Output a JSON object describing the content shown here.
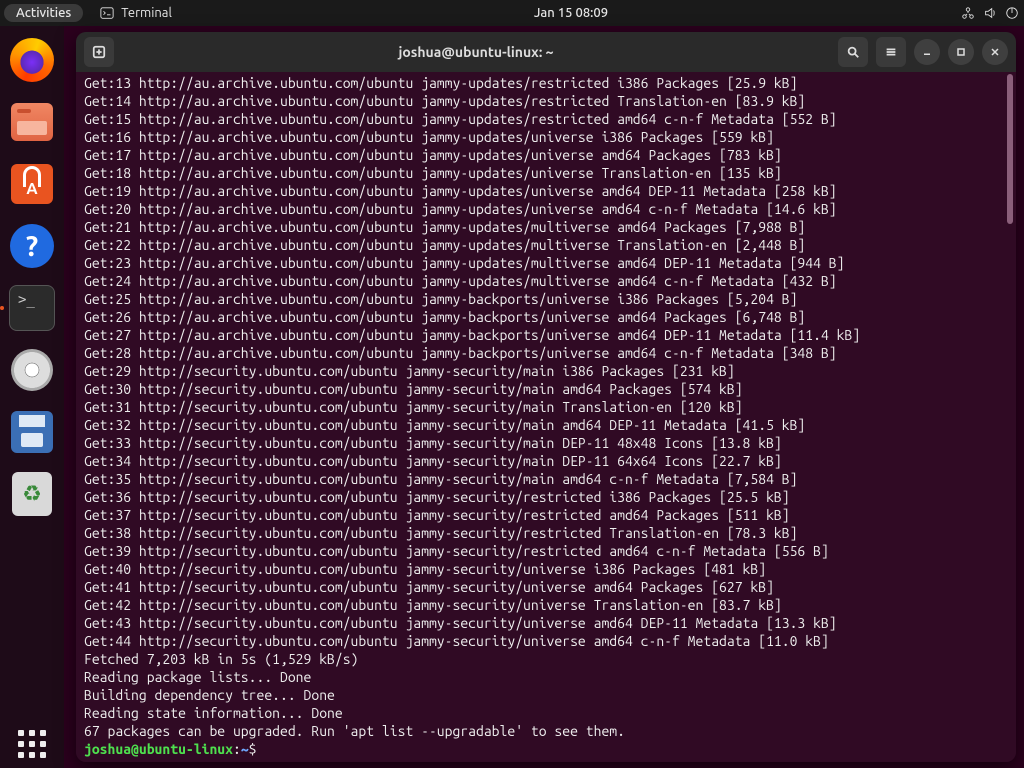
{
  "topbar": {
    "activities": "Activities",
    "app_label": "Terminal",
    "clock": "Jan 15  08:09"
  },
  "dock": {
    "items": [
      {
        "name": "firefox",
        "label": "Firefox"
      },
      {
        "name": "files",
        "label": "Files"
      },
      {
        "name": "software",
        "label": "Ubuntu Software"
      },
      {
        "name": "help",
        "label": "Help"
      },
      {
        "name": "terminal",
        "label": "Terminal",
        "active": true
      },
      {
        "name": "disks",
        "label": "Disk"
      },
      {
        "name": "save",
        "label": "Save"
      },
      {
        "name": "trash",
        "label": "Trash"
      }
    ],
    "show_apps": "Show Applications"
  },
  "window": {
    "title": "joshua@ubuntu-linux: ~",
    "new_tab_tooltip": "New Tab",
    "search_tooltip": "Search",
    "menu_tooltip": "Menu",
    "min_tooltip": "Minimize",
    "max_tooltip": "Maximize",
    "close_tooltip": "Close"
  },
  "terminal": {
    "lines": [
      "Get:13 http://au.archive.ubuntu.com/ubuntu jammy-updates/restricted i386 Packages [25.9 kB]",
      "Get:14 http://au.archive.ubuntu.com/ubuntu jammy-updates/restricted Translation-en [83.9 kB]",
      "Get:15 http://au.archive.ubuntu.com/ubuntu jammy-updates/restricted amd64 c-n-f Metadata [552 B]",
      "Get:16 http://au.archive.ubuntu.com/ubuntu jammy-updates/universe i386 Packages [559 kB]",
      "Get:17 http://au.archive.ubuntu.com/ubuntu jammy-updates/universe amd64 Packages [783 kB]",
      "Get:18 http://au.archive.ubuntu.com/ubuntu jammy-updates/universe Translation-en [135 kB]",
      "Get:19 http://au.archive.ubuntu.com/ubuntu jammy-updates/universe amd64 DEP-11 Metadata [258 kB]",
      "Get:20 http://au.archive.ubuntu.com/ubuntu jammy-updates/universe amd64 c-n-f Metadata [14.6 kB]",
      "Get:21 http://au.archive.ubuntu.com/ubuntu jammy-updates/multiverse amd64 Packages [7,988 B]",
      "Get:22 http://au.archive.ubuntu.com/ubuntu jammy-updates/multiverse Translation-en [2,448 B]",
      "Get:23 http://au.archive.ubuntu.com/ubuntu jammy-updates/multiverse amd64 DEP-11 Metadata [944 B]",
      "Get:24 http://au.archive.ubuntu.com/ubuntu jammy-updates/multiverse amd64 c-n-f Metadata [432 B]",
      "Get:25 http://au.archive.ubuntu.com/ubuntu jammy-backports/universe i386 Packages [5,204 B]",
      "Get:26 http://au.archive.ubuntu.com/ubuntu jammy-backports/universe amd64 Packages [6,748 B]",
      "Get:27 http://au.archive.ubuntu.com/ubuntu jammy-backports/universe amd64 DEP-11 Metadata [11.4 kB]",
      "Get:28 http://au.archive.ubuntu.com/ubuntu jammy-backports/universe amd64 c-n-f Metadata [348 B]",
      "Get:29 http://security.ubuntu.com/ubuntu jammy-security/main i386 Packages [231 kB]",
      "Get:30 http://security.ubuntu.com/ubuntu jammy-security/main amd64 Packages [574 kB]",
      "Get:31 http://security.ubuntu.com/ubuntu jammy-security/main Translation-en [120 kB]",
      "Get:32 http://security.ubuntu.com/ubuntu jammy-security/main amd64 DEP-11 Metadata [41.5 kB]",
      "Get:33 http://security.ubuntu.com/ubuntu jammy-security/main DEP-11 48x48 Icons [13.8 kB]",
      "Get:34 http://security.ubuntu.com/ubuntu jammy-security/main DEP-11 64x64 Icons [22.7 kB]",
      "Get:35 http://security.ubuntu.com/ubuntu jammy-security/main amd64 c-n-f Metadata [7,584 B]",
      "Get:36 http://security.ubuntu.com/ubuntu jammy-security/restricted i386 Packages [25.5 kB]",
      "Get:37 http://security.ubuntu.com/ubuntu jammy-security/restricted amd64 Packages [511 kB]",
      "Get:38 http://security.ubuntu.com/ubuntu jammy-security/restricted Translation-en [78.3 kB]",
      "Get:39 http://security.ubuntu.com/ubuntu jammy-security/restricted amd64 c-n-f Metadata [556 B]",
      "Get:40 http://security.ubuntu.com/ubuntu jammy-security/universe i386 Packages [481 kB]",
      "Get:41 http://security.ubuntu.com/ubuntu jammy-security/universe amd64 Packages [627 kB]",
      "Get:42 http://security.ubuntu.com/ubuntu jammy-security/universe Translation-en [83.7 kB]",
      "Get:43 http://security.ubuntu.com/ubuntu jammy-security/universe amd64 DEP-11 Metadata [13.3 kB]",
      "Get:44 http://security.ubuntu.com/ubuntu jammy-security/universe amd64 c-n-f Metadata [11.0 kB]",
      "Fetched 7,203 kB in 5s (1,529 kB/s)",
      "Reading package lists... Done",
      "Building dependency tree... Done",
      "Reading state information... Done",
      "67 packages can be upgraded. Run 'apt list --upgradable' to see them."
    ],
    "prompt": {
      "user_host": "joshua@ubuntu-linux",
      "sep": ":",
      "path": "~",
      "suffix": "$"
    }
  }
}
